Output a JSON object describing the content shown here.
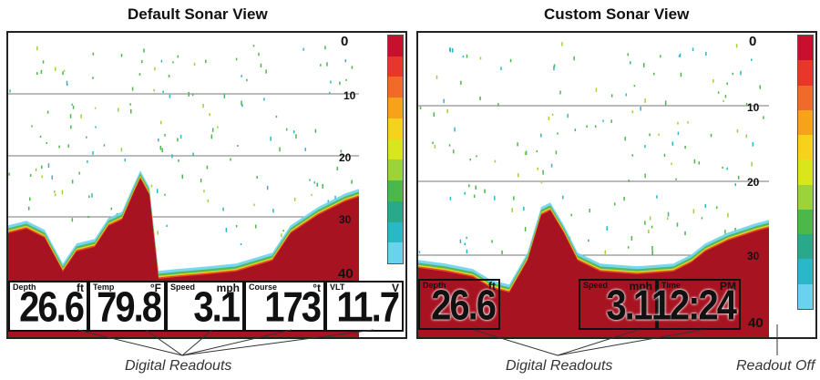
{
  "left": {
    "title": "Default Sonar View",
    "depth_scale": [
      "0",
      "10",
      "20",
      "30",
      "40"
    ],
    "readouts": [
      {
        "label": "Depth",
        "unit": "ft",
        "value": "26.6"
      },
      {
        "label": "Temp",
        "unit": "°F",
        "value": "79.8"
      },
      {
        "label": "Speed",
        "unit": "mph",
        "value": "3.1"
      },
      {
        "label": "Course",
        "unit": "°t",
        "value": "173"
      },
      {
        "label": "VLT",
        "unit": "V",
        "value": "11.7"
      }
    ],
    "caption": "Digital Readouts"
  },
  "right": {
    "title": "Custom Sonar View",
    "depth_scale": [
      "0",
      "10",
      "20",
      "30",
      "40"
    ],
    "readouts": [
      {
        "label": "Depth",
        "unit": "ft",
        "value": "26.6"
      },
      {
        "label": "Speed",
        "unit": "mph",
        "value": "3.1"
      },
      {
        "label": "Time",
        "unit": "PM",
        "value": "12:24"
      }
    ],
    "caption": "Digital Readouts",
    "caption_off": "Readout Off"
  },
  "palette": [
    "#c8102e",
    "#e8362a",
    "#f06a2a",
    "#f7a21b",
    "#f7d21b",
    "#d8e61b",
    "#9cd23a",
    "#4cb84a",
    "#2aa88a",
    "#2ab8c8",
    "#6ad2ee"
  ]
}
